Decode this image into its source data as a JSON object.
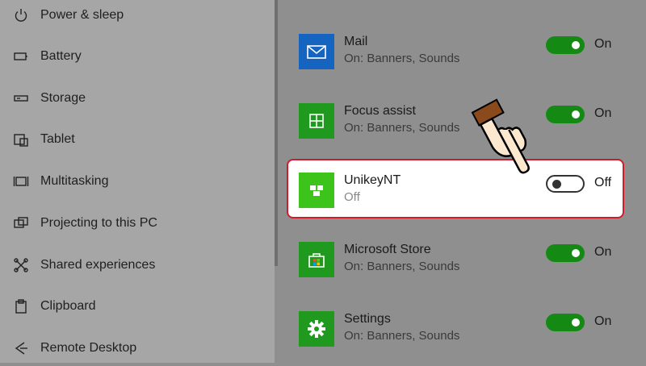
{
  "sidebar": {
    "items": [
      {
        "label": "Power & sleep",
        "icon": "power-icon"
      },
      {
        "label": "Battery",
        "icon": "battery-icon"
      },
      {
        "label": "Storage",
        "icon": "storage-icon"
      },
      {
        "label": "Tablet",
        "icon": "tablet-icon"
      },
      {
        "label": "Multitasking",
        "icon": "multitasking-icon"
      },
      {
        "label": "Projecting to this PC",
        "icon": "projecting-icon"
      },
      {
        "label": "Shared experiences",
        "icon": "shared-experiences-icon"
      },
      {
        "label": "Clipboard",
        "icon": "clipboard-icon"
      },
      {
        "label": "Remote Desktop",
        "icon": "remote-desktop-icon"
      }
    ]
  },
  "apps": [
    {
      "name": "Mail",
      "status": "On: Banners, Sounds",
      "toggle": "On",
      "state": "on",
      "tile_color": "#1565c0",
      "icon": "mail-icon"
    },
    {
      "name": "Focus assist",
      "status": "On: Banners, Sounds",
      "toggle": "On",
      "state": "on",
      "tile_color": "#1f9a1f",
      "icon": "focus-assist-icon"
    },
    {
      "name": "UnikeyNT",
      "status": "Off",
      "toggle": "Off",
      "state": "off",
      "tile_color": "#3cc41a",
      "icon": "unikey-icon"
    },
    {
      "name": "Microsoft Store",
      "status": "On: Banners, Sounds",
      "toggle": "On",
      "state": "on",
      "tile_color": "#1f9a1f",
      "icon": "store-icon"
    },
    {
      "name": "Settings",
      "status": "On: Banners, Sounds",
      "toggle": "On",
      "state": "on",
      "tile_color": "#1f9a1f",
      "icon": "gear-icon"
    }
  ],
  "colors": {
    "toggle_on": "#148a14",
    "highlight_border": "#d01c2a"
  }
}
